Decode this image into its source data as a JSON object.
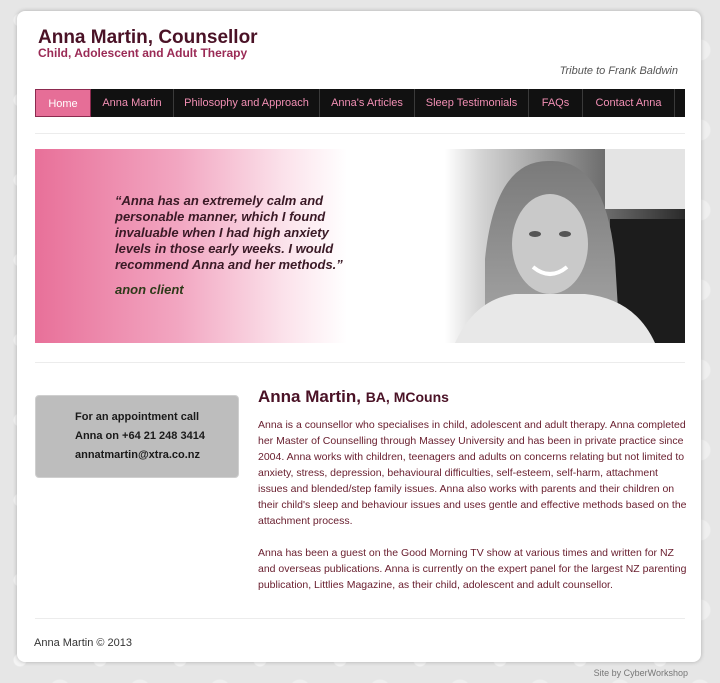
{
  "header": {
    "title": "Anna Martin, Counsellor",
    "subtitle": "Child, Adolescent and Adult Therapy",
    "tribute": "Tribute to Frank Baldwin"
  },
  "nav": {
    "items": [
      {
        "label": "Home",
        "active": true
      },
      {
        "label": "Anna Martin",
        "active": false
      },
      {
        "label": "Philosophy and Approach",
        "active": false
      },
      {
        "label": "Anna's Articles",
        "active": false
      },
      {
        "label": "Sleep Testimonials",
        "active": false
      },
      {
        "label": "FAQs",
        "active": false
      },
      {
        "label": "Contact Anna",
        "active": false
      }
    ]
  },
  "banner": {
    "quote": "“Anna has an extremely calm and personable manner, which I found invaluable when I had high anxiety levels in those early weeks. I would recommend Anna and her methods.”",
    "author": "anon client"
  },
  "contact": {
    "line1": "For an appointment call",
    "line2": "Anna on +64 21 248 3414",
    "line3": "annatmartin@xtra.co.nz"
  },
  "main": {
    "heading": "Anna Martin,",
    "quals": "BA, MCouns",
    "para1": "Anna is a counsellor who specialises in child, adolescent and adult therapy. Anna completed her Master of Counselling through Massey University and has been in private practice since 2004. Anna works with children, teenagers and adults on concerns relating but not limited to anxiety, stress, depression, behavioural difficulties, self-esteem, self-harm, attachment issues and blended/step family issues. Anna also works with parents and their children on their child's sleep and behaviour issues and uses gentle and effective methods based on the attachment process.",
    "para2": "Anna has been a guest on the Good Morning TV show at various times and written for NZ and overseas publications. Anna is currently on the expert panel for the largest NZ parenting publication, Littlies Magazine, as their child, adolescent and adult counsellor."
  },
  "footer": {
    "copyright": "Anna Martin © 2013",
    "credit": "Site by CyberWorkshop"
  }
}
